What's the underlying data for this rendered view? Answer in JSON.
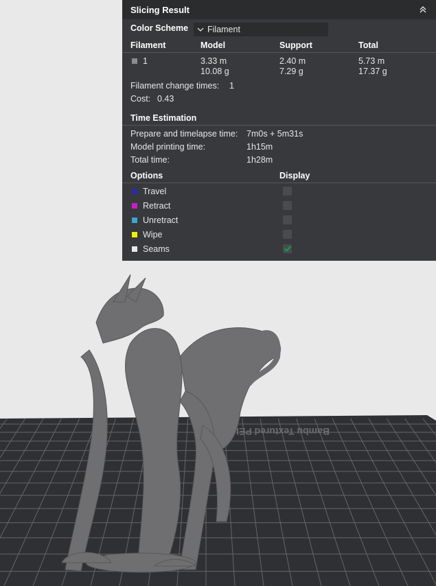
{
  "panel": {
    "title": "Slicing Result",
    "color_scheme_label": "Color Scheme",
    "color_scheme_value": "Filament"
  },
  "filament_table": {
    "headers": [
      "Filament",
      "Model",
      "Support",
      "Total"
    ],
    "row": {
      "id": "1",
      "model_len": "3.33 m",
      "model_wt": "10.08 g",
      "support_len": "2.40 m",
      "support_wt": "7.29 g",
      "total_len": "5.73 m",
      "total_wt": "17.37 g"
    },
    "swatch_color": "#8c8c8c"
  },
  "stats": {
    "change_label": "Filament change times:",
    "change_value": "1",
    "cost_label": "Cost:",
    "cost_value": "0.43"
  },
  "time": {
    "title": "Time Estimation",
    "rows": [
      {
        "label": "Prepare and timelapse time:",
        "value": "7m0s + 5m31s"
      },
      {
        "label": "Model printing time:",
        "value": "1h15m"
      },
      {
        "label": "Total time:",
        "value": "1h28m"
      }
    ]
  },
  "options": {
    "title": "Options",
    "display_title": "Display",
    "items": [
      {
        "label": "Travel",
        "color": "#2b2ba8",
        "checked": false
      },
      {
        "label": "Retract",
        "color": "#c61fc6",
        "checked": false
      },
      {
        "label": "Unretract",
        "color": "#3aa6d4",
        "checked": false
      },
      {
        "label": "Wipe",
        "color": "#f2f200",
        "checked": false
      },
      {
        "label": "Seams",
        "color": "#e8e8e8",
        "checked": true
      }
    ]
  },
  "plate": {
    "label": "Bambu Textured PEI Plate",
    "surface_color": "#2f3033",
    "grid_color": "#64666a"
  },
  "model": {
    "color": "#6f6f71"
  }
}
